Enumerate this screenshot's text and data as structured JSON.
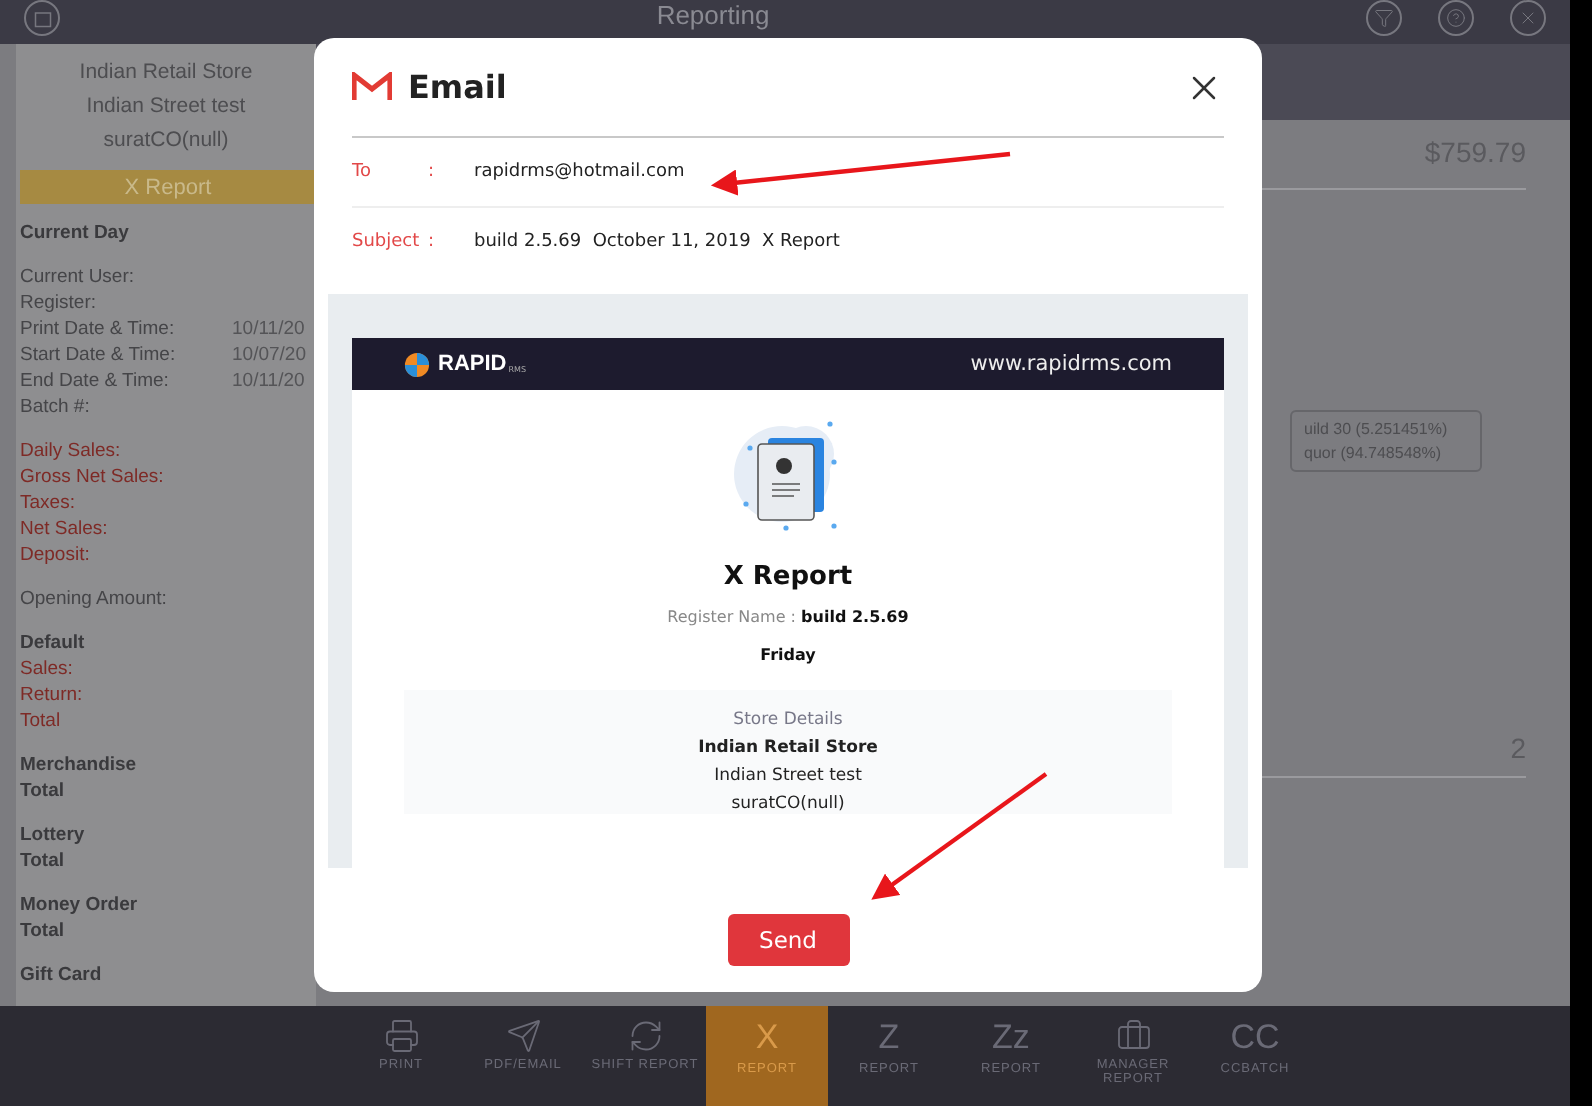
{
  "app": {
    "title": "Reporting"
  },
  "report_panel": {
    "store_lines": [
      "Indian Retail Store",
      "Indian Street test",
      "suratCO(null)"
    ],
    "banner": "X Report",
    "sections": [
      {
        "rows": [
          {
            "kind": "heading",
            "label": "Current Day"
          }
        ]
      },
      {
        "rows": [
          {
            "kind": "field",
            "label": "Current User:"
          },
          {
            "kind": "field",
            "label": "Register:"
          },
          {
            "kind": "field",
            "label": "Print Date & Time:",
            "value": "10/11/20"
          },
          {
            "kind": "field",
            "label": "Start Date & Time:",
            "value": "10/07/20"
          },
          {
            "kind": "field",
            "label": "End Date & Time:",
            "value": "10/11/20"
          },
          {
            "kind": "field",
            "label": "Batch #:"
          }
        ]
      },
      {
        "rows": [
          {
            "kind": "sales",
            "label": "Daily Sales:"
          },
          {
            "kind": "sales",
            "label": "Gross Net Sales:"
          },
          {
            "kind": "sales",
            "label": "Taxes:"
          },
          {
            "kind": "sales",
            "label": "Net Sales:"
          },
          {
            "kind": "sales",
            "label": "Deposit:"
          }
        ]
      },
      {
        "rows": [
          {
            "kind": "field",
            "label": "Opening Amount:"
          }
        ]
      },
      {
        "rows": [
          {
            "kind": "heading",
            "label": "Default"
          },
          {
            "kind": "sales",
            "label": "Sales:"
          },
          {
            "kind": "sales",
            "label": "Return:"
          },
          {
            "kind": "sales",
            "label": "Total"
          }
        ]
      },
      {
        "rows": [
          {
            "kind": "heading",
            "label": "Merchandise"
          },
          {
            "kind": "heading",
            "label": "Total"
          }
        ]
      },
      {
        "rows": [
          {
            "kind": "heading",
            "label": "Lottery"
          },
          {
            "kind": "heading",
            "label": "Total"
          }
        ]
      },
      {
        "rows": [
          {
            "kind": "heading",
            "label": "Money Order"
          },
          {
            "kind": "heading",
            "label": "Total"
          }
        ]
      },
      {
        "rows": [
          {
            "kind": "heading",
            "label": "Gift Card"
          }
        ]
      }
    ]
  },
  "summary": {
    "amount": "$759.79",
    "legend": [
      "uild 30 (5.251451%)",
      "quor (94.748548%)"
    ],
    "count": "2"
  },
  "toolbar": [
    {
      "kind": "icon",
      "label": "PRINT",
      "selected": false
    },
    {
      "kind": "icon",
      "label": "PDF/EMAIL",
      "selected": false
    },
    {
      "kind": "icon",
      "label": "SHIFT REPORT",
      "selected": false
    },
    {
      "kind": "glyph",
      "glyph": "X",
      "label": "REPORT",
      "selected": true
    },
    {
      "kind": "glyph",
      "glyph": "Z",
      "label": "REPORT",
      "selected": false
    },
    {
      "kind": "glyph",
      "glyph": "Zz",
      "label": "REPORT",
      "selected": false
    },
    {
      "kind": "icon",
      "label": "MANAGER REPORT",
      "selected": false
    },
    {
      "kind": "glyph",
      "glyph": "CC",
      "label": "CCBATCH",
      "selected": false
    }
  ],
  "email_dialog": {
    "title": "Email",
    "to_label": "To",
    "to_colon": ":",
    "to": "rapidrms@hotmail.com",
    "subject_label": "Subject",
    "subject_colon": ":",
    "subject": "build 2.5.69  October 11, 2019  X Report",
    "preview": {
      "brand": "RAPID",
      "brand_suffix": "RMS",
      "website": "www.rapidrms.com",
      "report_title": "X Report",
      "register_line": "Register Name : **build 2.5.69**",
      "day": "Friday",
      "store_heading": "Store Details",
      "store_name": "Indian Retail Store",
      "store_street": "Indian Street test",
      "store_city": "suratCO(null)"
    },
    "send_button": "Send"
  }
}
